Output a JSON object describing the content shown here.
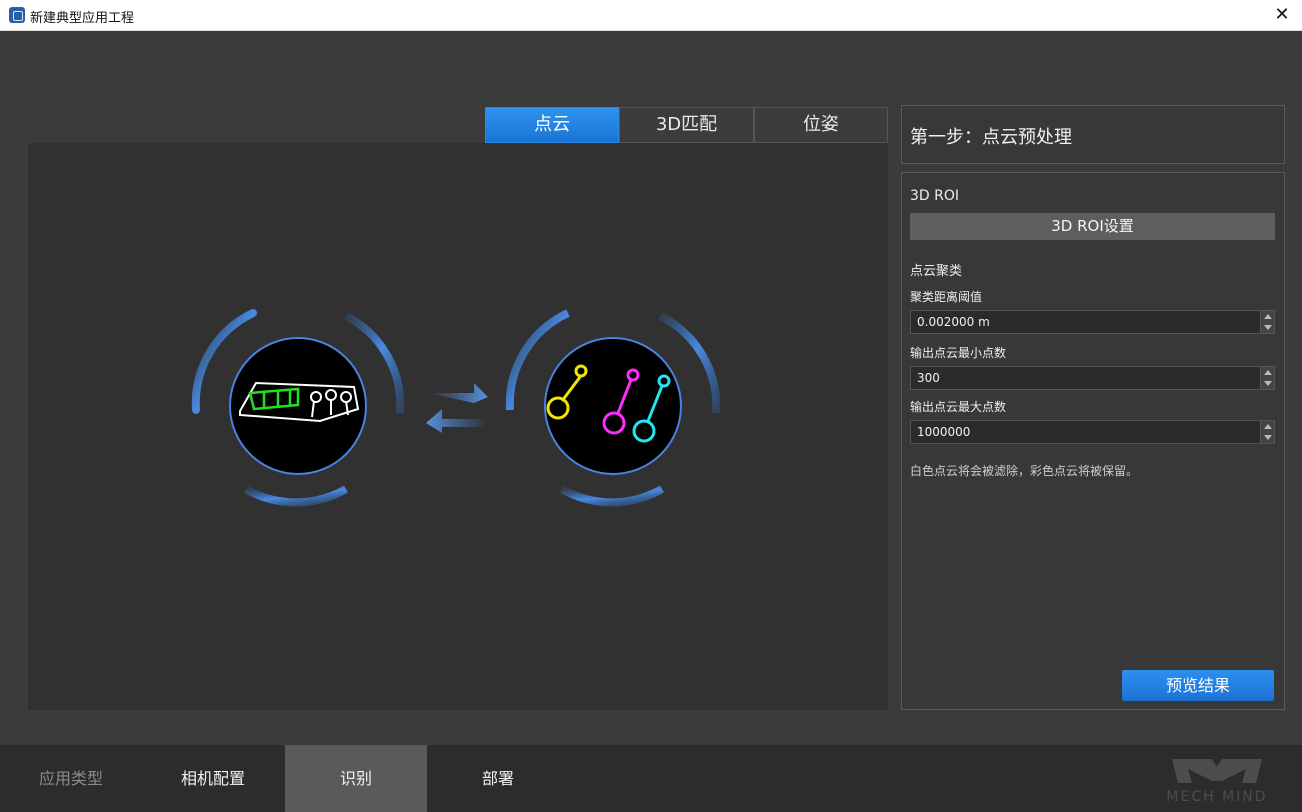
{
  "window": {
    "title": "新建典型应用工程",
    "close_icon": "close-icon"
  },
  "view_tabs": [
    {
      "label": "点云",
      "active": true
    },
    {
      "label": "3D匹配",
      "active": false
    },
    {
      "label": "位姿",
      "active": false
    }
  ],
  "step": {
    "title": "第一步：点云预处理"
  },
  "settings": {
    "roi_section": "3D ROI",
    "roi_button": "3D ROI设置",
    "cluster_section": "点云聚类",
    "distance_label": "聚类距离阈值",
    "distance_value": "0.002000 m",
    "min_points_label": "输出点云最小点数",
    "min_points_value": "300",
    "max_points_label": "输出点云最大点数",
    "max_points_value": "1000000",
    "note": "白色点云将会被滤除，彩色点云将被保留。",
    "preview_button": "预览结果"
  },
  "bottom_nav": [
    {
      "label": "应用类型",
      "state": "dim"
    },
    {
      "label": "相机配置",
      "state": "normal"
    },
    {
      "label": "识别",
      "state": "active"
    },
    {
      "label": "部署",
      "state": "normal"
    }
  ],
  "brand": "MECH MIND",
  "colors": {
    "accent": "#1f7fe0",
    "background": "#3b3b3b",
    "viewer": "#313131"
  }
}
